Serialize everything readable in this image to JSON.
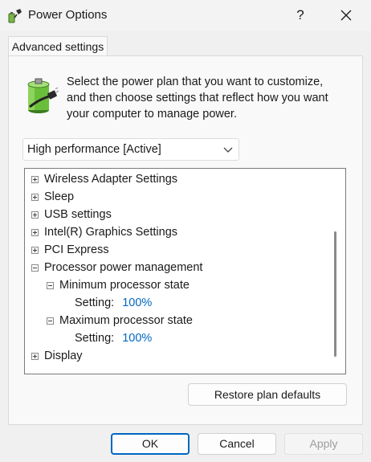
{
  "window": {
    "title": "Power Options",
    "help_label": "?",
    "icon": "power-options-icon",
    "close_icon": "close-icon"
  },
  "tabs": [
    {
      "label": "Advanced settings",
      "active": true
    }
  ],
  "description": "Select the power plan that you want to customize, and then choose settings that reflect how you want your computer to manage power.",
  "plan_select": {
    "value": "High performance [Active]",
    "icon": "chevron-down-icon"
  },
  "tree": {
    "items": [
      {
        "label": "Wireless Adapter Settings",
        "expanded": false
      },
      {
        "label": "Sleep",
        "expanded": false
      },
      {
        "label": "USB settings",
        "expanded": false
      },
      {
        "label": "Intel(R) Graphics Settings",
        "expanded": false
      },
      {
        "label": "PCI Express",
        "expanded": false
      },
      {
        "label": "Processor power management",
        "expanded": true,
        "children": [
          {
            "label": "Minimum processor state",
            "expanded": true,
            "setting_label": "Setting:",
            "setting_value": "100%"
          },
          {
            "label": "Maximum processor state",
            "expanded": true,
            "setting_label": "Setting:",
            "setting_value": "100%"
          }
        ]
      },
      {
        "label": "Display",
        "expanded": false
      }
    ]
  },
  "buttons": {
    "restore": "Restore plan defaults",
    "ok": "OK",
    "cancel": "Cancel",
    "apply": "Apply",
    "apply_enabled": false
  },
  "colors": {
    "accent": "#0067c0",
    "setting_value": "#0067c0"
  }
}
